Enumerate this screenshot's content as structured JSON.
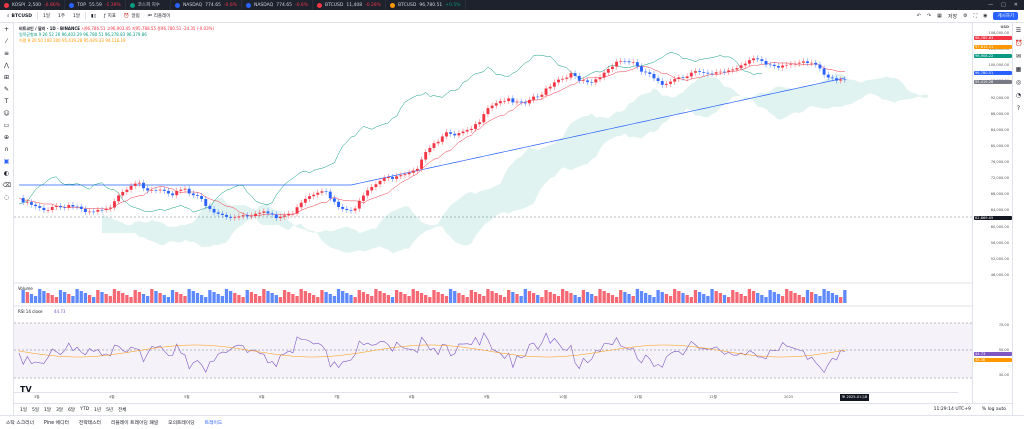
{
  "tabs": [
    {
      "name": "KOSPI",
      "value": "2,500",
      "change": "-0.86%",
      "dot": "#f23645"
    },
    {
      "name": "TOP",
      "value": "55.59",
      "change": "-1.39%",
      "dot": "#2962ff"
    },
    {
      "name": "코스피 지수",
      "value": "",
      "change": "",
      "dot": "#089981"
    },
    {
      "name": "NASDAQ",
      "value": "774.65",
      "change": "-0.6%",
      "dot": "#2962ff"
    },
    {
      "name": "NASDAQ",
      "value": "774.65",
      "change": "-0.6%",
      "dot": "#2962ff"
    },
    {
      "name": "BTCUSD",
      "value": "11,408",
      "change": "-0.28%",
      "dot": "#f23645"
    },
    {
      "name": "BTCUSD",
      "value": "96,780.51",
      "change": "+0.5%",
      "dot": "#ff9800"
    }
  ],
  "window": {
    "minimize": "—",
    "maximize": "□",
    "close": "✕"
  },
  "toolbar": {
    "symbol": "BTCUSD",
    "intervals": [
      "1일",
      "1주",
      "1달"
    ],
    "indicators_label": "지표",
    "alert_label": "알림",
    "replay_label": "리플레이",
    "save_label": "저장",
    "publish_label": "게시하기"
  },
  "legend": {
    "title": "비트코인 / 달러 · 1D · BINANCE",
    "ohlc": "시96,786.51 고96,903.45 저95,788.55 종96,780.51 -24.35 (-0.03%)",
    "ichimoku": "일목균형표 9 26 52 26  96,403.29  96,780.51  96,278.83  96,379.86",
    "ma_line": "이평 9 20 50 100 200  95,419.28  95,929.33  94,116.19"
  },
  "price_axis": {
    "ticks": [
      "108,000.00",
      "104,000.00",
      "100,000.00",
      "96,000.00",
      "92,000.00",
      "88,000.00",
      "84,000.00",
      "80,000.00",
      "76,000.00",
      "72,000.00",
      "68,000.00",
      "64,000.00",
      "60,000.00",
      "56,000.00",
      "52,000.00",
      "48,000.00"
    ],
    "current_label": "96,780.51",
    "labels": [
      {
        "text": "98,785.63",
        "color": "#f23645"
      },
      {
        "text": "97,815.21",
        "color": "#ff9800"
      },
      {
        "text": "96,908.22",
        "color": "#089981"
      },
      {
        "text": "96,780.51",
        "color": "#2962ff"
      },
      {
        "text": "95,419.28",
        "color": "#787b86"
      },
      {
        "text": "62,869.05",
        "color": "#131722"
      }
    ],
    "currency": "USD"
  },
  "time_axis": {
    "ticks": [
      "3월",
      "4월",
      "5월",
      "6월",
      "7월",
      "8월",
      "9월",
      "10월",
      "11월",
      "12월",
      "2025",
      "2월"
    ],
    "current_time": "토 2025-01-18"
  },
  "volume": {
    "label": "Volume"
  },
  "rsi": {
    "label": "RSI 14 close",
    "value": "44.73",
    "ticks": [
      "70.00",
      "50.00",
      "30.00"
    ],
    "labels": [
      {
        "text": "44.73",
        "color": "#7e57c2"
      },
      {
        "text": "45.36",
        "color": "#ff9800"
      }
    ]
  },
  "range_bar": {
    "items": [
      "1일",
      "5일",
      "1달",
      "3달",
      "6달",
      "YTD",
      "1년",
      "5년",
      "전체"
    ],
    "time": "11:29:14 UTC+9",
    "mode": "%  log  auto"
  },
  "bottom_tabs": [
    "스탁 스크리너",
    "Pine 에디터",
    "전략테스터",
    "리플레이 트레이딩 패널",
    "모의트레이딩",
    "트레이드"
  ],
  "colors": {
    "up": "#f23645",
    "down": "#2962ff",
    "accent": "#2962ff"
  }
}
